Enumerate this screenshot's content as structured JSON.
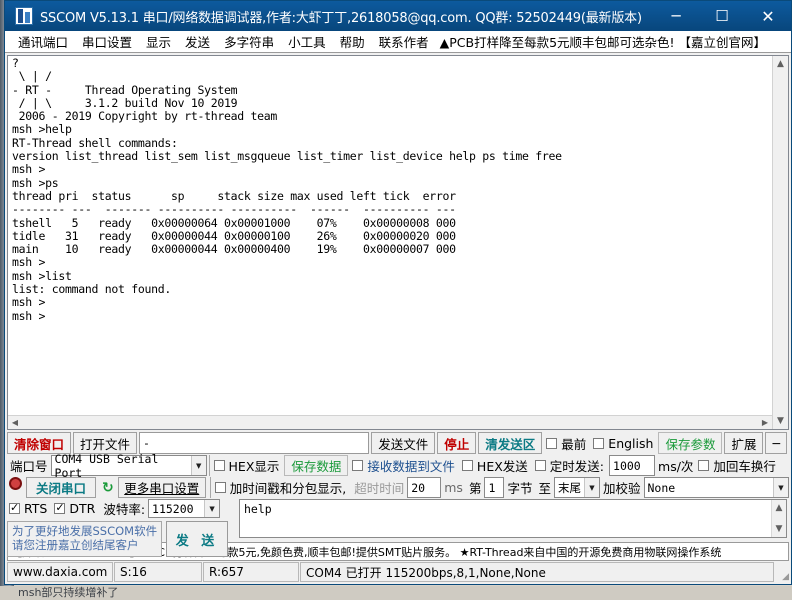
{
  "window": {
    "title": "SSCOM V5.13.1 串口/网络数据调试器,作者:大虾丁丁,2618058@qq.com. QQ群: 52502449(最新版本)",
    "minimize": "─",
    "maximize": "☐",
    "close": "✕"
  },
  "menu": {
    "items": [
      "通讯端口",
      "串口设置",
      "显示",
      "发送",
      "多字符串",
      "小工具",
      "帮助",
      "联系作者"
    ],
    "ad": "▲PCB打样降至每款5元顺丰包邮可选杂色!  【嘉立创官网】"
  },
  "terminal": {
    "text": "?\n \\ | /\n- RT -     Thread Operating System\n / | \\     3.1.2 build Nov 10 2019\n 2006 - 2019 Copyright by rt-thread team\nmsh >help\nRT-Thread shell commands:\nversion list_thread list_sem list_msgqueue list_timer list_device help ps time free\nmsh >\nmsh >ps\nthread pri  status      sp     stack size max used left tick  error\n-------- ---  ------- ---------- ----------  ------  ---------- ---\ntshell   5   ready   0x00000064 0x00001000    07%    0x00000008 000\ntidle   31   ready   0x00000044 0x00000100    26%    0x00000020 000\nmain    10   ready   0x00000044 0x00000400    19%    0x00000007 000\nmsh >\nmsh >list\nlist: command not found.\nmsh >\nmsh >"
  },
  "toolbar1": {
    "clear_window": "清除窗口",
    "open_file": "打开文件",
    "file_path": "-",
    "send_file": "发送文件",
    "stop": "停止",
    "clear_send": "清发送区",
    "topmost": "最前",
    "english": "English",
    "save_params": "保存参数",
    "expand": "扩展",
    "collapse": "─"
  },
  "port_row": {
    "port_label": "端口号",
    "port_value": "COM4 USB Serial Port",
    "hex_display": "HEX显示",
    "save_data": "保存数据",
    "recv_to_file": "接收数据到文件",
    "hex_send": "HEX发送",
    "timed_send": "定时发送:",
    "timed_value": "1000",
    "timed_unit": "ms/次",
    "add_crlf": "加回车换行"
  },
  "port_row2": {
    "close_port": "关闭串口",
    "more_settings": "更多串口设置",
    "timestamp": "加时间戳和分包显示,",
    "timeout_label": "超时时间",
    "timeout_value": "20",
    "timeout_unit": "ms",
    "byte_prefix": "第",
    "byte_value": "1",
    "byte_label": "字节",
    "to_label": "至",
    "to_value": "末尾",
    "checksum_label": "加校验",
    "checksum_value": "None"
  },
  "baud_row": {
    "rts": "RTS",
    "dtr": "DTR",
    "baud_label": "波特率:",
    "baud_value": "115200"
  },
  "register": {
    "line1": "为了更好地发展SSCOM软件",
    "line2": "请您注册嘉立创结尾客户",
    "send_button": "发 送"
  },
  "send_area": {
    "text": "help"
  },
  "ad_strip": {
    "text": "【升级到SSCOM5.13.1】★PCB打样降至每款5元,免颜色费,顺丰包邮!提供SMT贴片服务。 ★RT-Thread来自中国的开源免费商用物联网操作系统"
  },
  "status": {
    "url": "www.daxia.com",
    "sent": "S:16",
    "received": "R:657",
    "info": "COM4 已打开  115200bps,8,1,None,None"
  },
  "background": {
    "bottom_text": "msh部只持续增补了"
  },
  "colors": {
    "title_bar": "#0b5394",
    "accent_red": "#c00000",
    "accent_teal": "#0b7a84",
    "accent_green": "#1a9a3a",
    "link_blue": "#1d4f8f"
  }
}
